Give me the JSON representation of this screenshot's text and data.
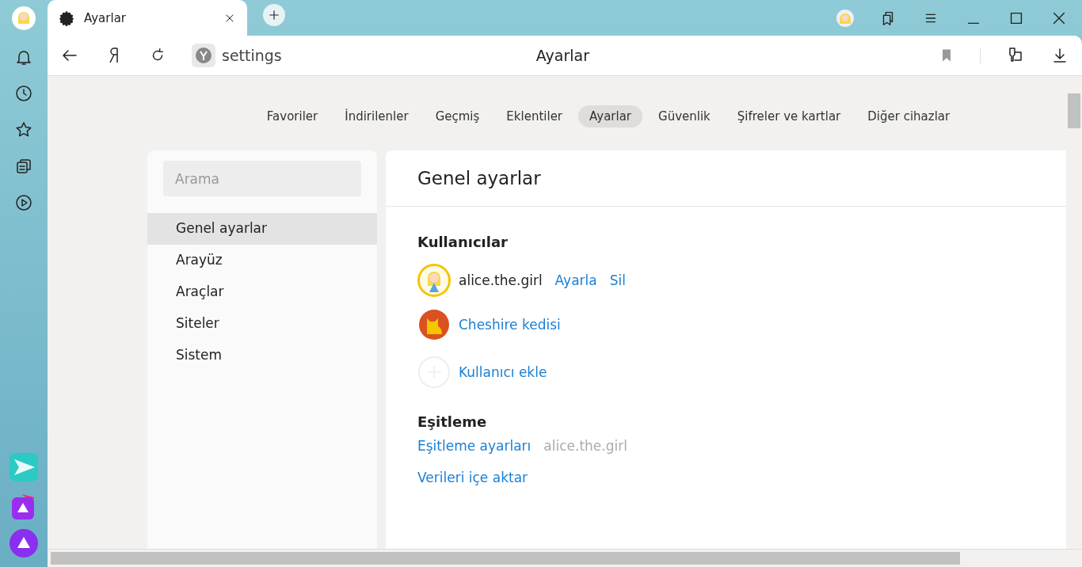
{
  "tab": {
    "title": "Ayarlar"
  },
  "address_bar": {
    "url": "settings",
    "page_title": "Ayarlar"
  },
  "nav_tabs": [
    {
      "label": "Favoriler",
      "selected": false
    },
    {
      "label": "İndirilenler",
      "selected": false
    },
    {
      "label": "Geçmiş",
      "selected": false
    },
    {
      "label": "Eklentiler",
      "selected": false
    },
    {
      "label": "Ayarlar",
      "selected": true
    },
    {
      "label": "Güvenlik",
      "selected": false
    },
    {
      "label": "Şifreler ve kartlar",
      "selected": false
    },
    {
      "label": "Diğer cihazlar",
      "selected": false
    }
  ],
  "sidebar": {
    "search": {
      "placeholder": "Arama"
    },
    "items": [
      {
        "label": "Genel ayarlar",
        "selected": true
      },
      {
        "label": "Arayüz",
        "selected": false
      },
      {
        "label": "Araçlar",
        "selected": false
      },
      {
        "label": "Siteler",
        "selected": false
      },
      {
        "label": "Sistem",
        "selected": false
      }
    ]
  },
  "panel": {
    "title": "Genel ayarlar",
    "users": {
      "heading": "Kullanıcılar",
      "items": [
        {
          "kind": "current",
          "name": "alice.the.girl",
          "actions": [
            "Ayarla",
            "Sil"
          ]
        },
        {
          "kind": "other",
          "name": "Cheshire kedisi"
        }
      ],
      "add_label": "Kullanıcı ekle"
    },
    "sync": {
      "heading": "Eşitleme",
      "settings_link": "Eşitleme ayarları",
      "account": "alice.the.girl",
      "import_link": "Verileri içe aktar"
    }
  }
}
